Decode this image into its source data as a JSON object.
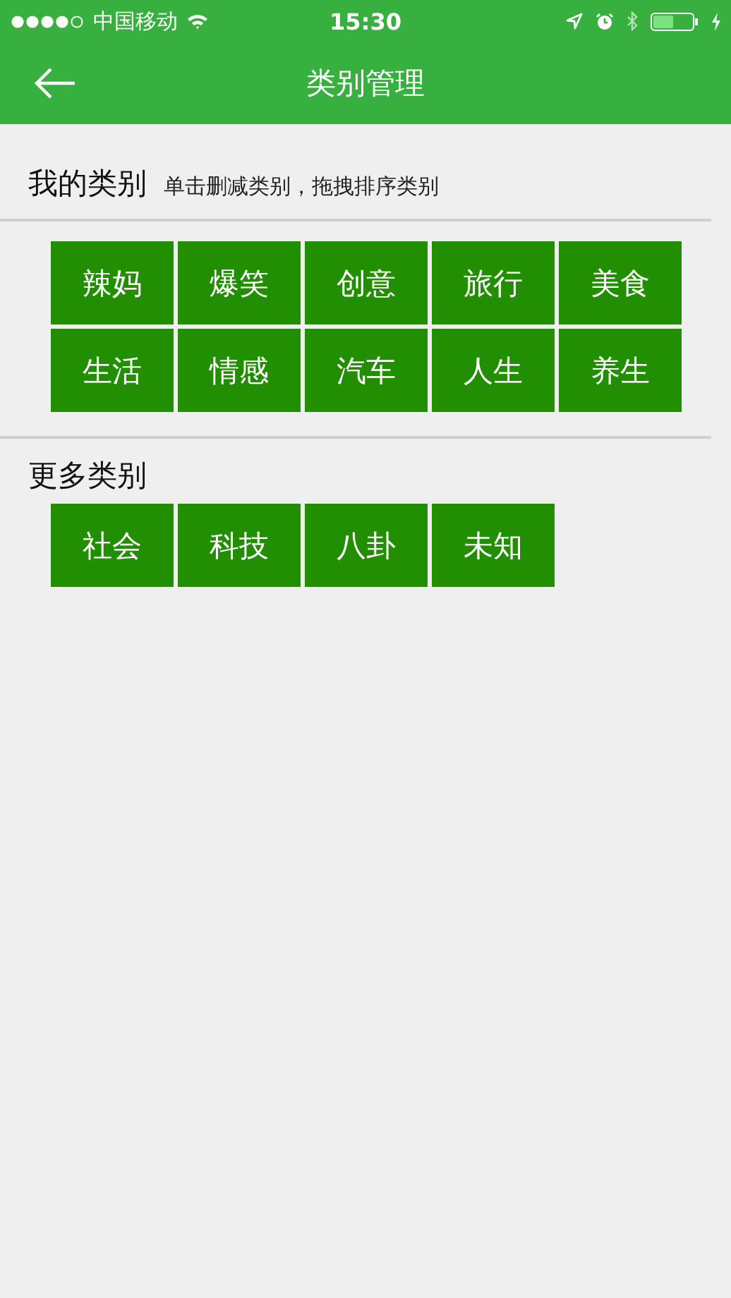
{
  "status_bar": {
    "carrier": "中国移动",
    "time": "15:30"
  },
  "nav": {
    "title": "类别管理"
  },
  "sections": [
    {
      "title": "我的类别",
      "hint": "单击删减类别，拖拽排序类别",
      "categories": [
        "辣妈",
        "爆笑",
        "创意",
        "旅行",
        "美食",
        "生活",
        "情感",
        "汽车",
        "人生",
        "养生"
      ]
    },
    {
      "title": "更多类别",
      "categories": [
        "社会",
        "科技",
        "八卦",
        "未知"
      ]
    }
  ]
}
